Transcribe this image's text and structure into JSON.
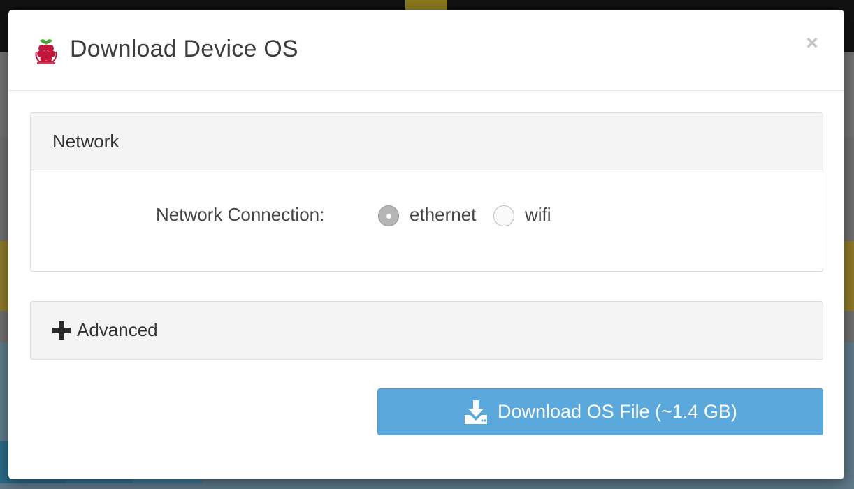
{
  "modal": {
    "title": "Download Device OS",
    "close_label": "×"
  },
  "network_panel": {
    "heading": "Network",
    "connection_label": "Network Connection:",
    "options": [
      {
        "label": "ethernet",
        "checked": true
      },
      {
        "label": "wifi",
        "checked": false
      }
    ]
  },
  "advanced_panel": {
    "heading": "Advanced"
  },
  "download_button": {
    "label": "Download OS File (~1.4 GB)"
  },
  "colors": {
    "accent": "#5ba8dc",
    "raspberry_red": "#c0163c",
    "leaf_green": "#3fa535"
  },
  "icons": {
    "brand": "raspberry-pi-icon",
    "close": "close-icon",
    "expand": "plus-icon",
    "download": "download-icon"
  }
}
